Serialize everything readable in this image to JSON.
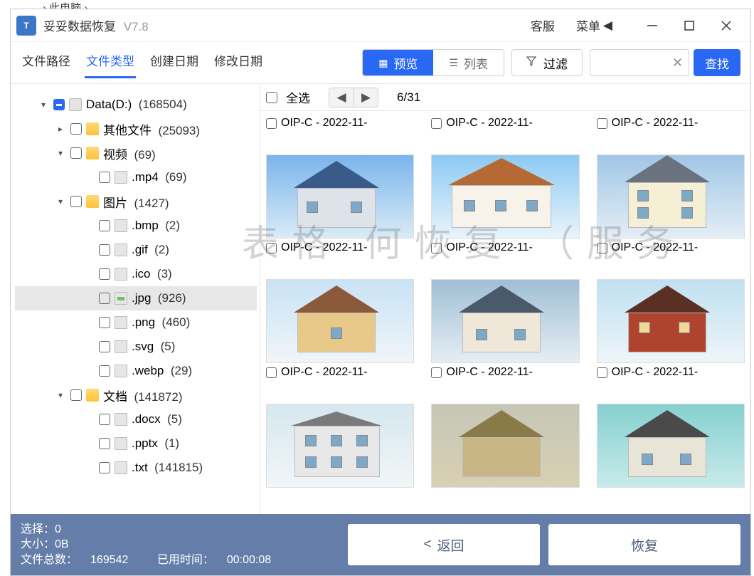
{
  "bg_hint": "此电脑",
  "titlebar": {
    "app_name": "妥妥数据恢复",
    "version": "V7.8",
    "service_link": "客服",
    "menu_link": "菜单"
  },
  "tabs": {
    "t0": "文件路径",
    "t1": "文件类型",
    "t2": "创建日期",
    "t3": "修改日期"
  },
  "viewseg": {
    "preview": "预览",
    "list": "列表"
  },
  "filter_label": "过滤",
  "search_btn": "查找",
  "tree": {
    "root_label": "Data(D:)",
    "root_count": "(168504)",
    "n_other": "其他文件",
    "c_other": "(25093)",
    "n_video": "视频",
    "c_video": "(69)",
    "n_mp4": ".mp4",
    "c_mp4": "(69)",
    "n_image": "图片",
    "c_image": "(1427)",
    "n_bmp": ".bmp",
    "c_bmp": "(2)",
    "n_gif": ".gif",
    "c_gif": "(2)",
    "n_ico": ".ico",
    "c_ico": "(3)",
    "n_jpg": ".jpg",
    "c_jpg": "(926)",
    "n_png": ".png",
    "c_png": "(460)",
    "n_svg": ".svg",
    "c_svg": "(5)",
    "n_webp": ".webp",
    "c_webp": "(29)",
    "n_doc": "文档",
    "c_doc": "(141872)",
    "n_docx": ".docx",
    "c_docx": "(5)",
    "n_pptx": ".pptx",
    "c_pptx": "(1)",
    "n_txt": ".txt",
    "c_txt": "(141815)"
  },
  "content": {
    "select_all": "全选",
    "page_label": "6/31",
    "item_caption": "OIP-C - 2022-11-"
  },
  "watermark": "表格   何恢复   （服务",
  "footer": {
    "sel_label": "选择：",
    "sel_value": "0",
    "size_label": "大小：",
    "size_value": "0B",
    "total_label": "文件总数：",
    "total_value": "169542",
    "time_label": "已用时间：",
    "time_value": "00:00:08",
    "back_btn": "返回",
    "recover_btn": "恢复"
  }
}
